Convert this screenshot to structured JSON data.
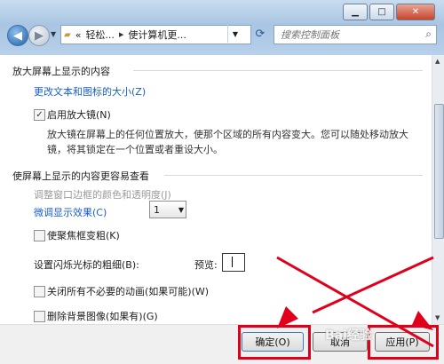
{
  "window": {
    "minimize_glyph": "▁",
    "maximize_glyph": "□",
    "close_glyph": "✕"
  },
  "nav": {
    "back_glyph": "◀",
    "forward_glyph": "▶",
    "breadcrumb": [
      "«",
      "轻松...",
      "使计算机更..."
    ],
    "search_placeholder": "搜索控制面板"
  },
  "section1": {
    "title": "放大屏幕上显示的内容",
    "link": "更改文本和图标的大小(Z)",
    "magnifier_checkbox": {
      "label": "启用放大镜(N)",
      "checked": true
    },
    "description": "放大镜在屏幕上的任何位置放大，使那个区域的所有内容变大。您可以随处移动放大镜，将其锁定在一个位置或者重设大小。"
  },
  "section2": {
    "title": "使屏幕上显示的内容更容易查看",
    "link_disabled": "调整窗口边框的颜色和透明度(J)",
    "link": "微调显示效果(C)",
    "focus_checkbox": {
      "label": "使聚焦框变粗(K)",
      "checked": false
    },
    "cursor_width_label": "设置闪烁光标的粗细(B):",
    "cursor_width_value": "1",
    "preview_label": "预览:",
    "animations_checkbox": {
      "label": "关闭所有不必要的动画(如果可能)(W)",
      "checked": false
    },
    "background_checkbox": {
      "label": "删除背景图像(如果有)(G)",
      "checked": false
    }
  },
  "footer": {
    "ok_label": "确定(O)",
    "cancel_label": "取消",
    "apply_label": "应用(P)",
    "watermark": "Bai经验"
  },
  "colors": {
    "link": "#1a5ec7",
    "annotation_red": "#e0001b"
  }
}
